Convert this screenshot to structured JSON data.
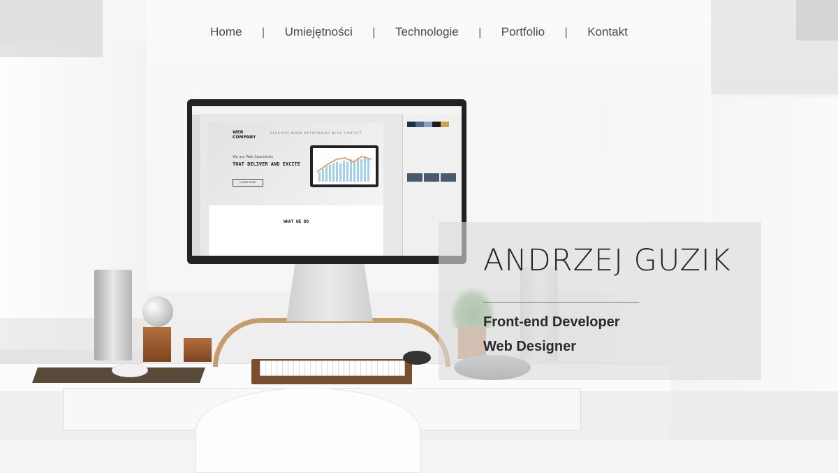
{
  "nav": {
    "items": [
      {
        "label": "Home"
      },
      {
        "label": "Umiejętności"
      },
      {
        "label": "Technologie"
      },
      {
        "label": "Portfolio"
      },
      {
        "label": "Kontakt"
      }
    ],
    "separator": "|"
  },
  "hero": {
    "name": "ANDRZEJ GUZIK",
    "roles": [
      "Front-end Developer",
      "Web Designer"
    ]
  },
  "monitor_screen": {
    "site_logo_line1": "WEB",
    "site_logo_line2": "COMPANY",
    "site_nav": "SERVICES  WORK  NETWORKING  BLOG  CONTACT",
    "tagline_small": "We are Web Specialists",
    "tagline": "THAT DELIVER AND EXCITE",
    "button": "LEARN MORE",
    "section_title": "WHAT WE DO"
  },
  "colors": {
    "text_dark": "#222222",
    "nav_text": "#4a4a4a",
    "panel_bg": "rgba(220,220,220,0.62)",
    "wood": "#c79b6a"
  }
}
